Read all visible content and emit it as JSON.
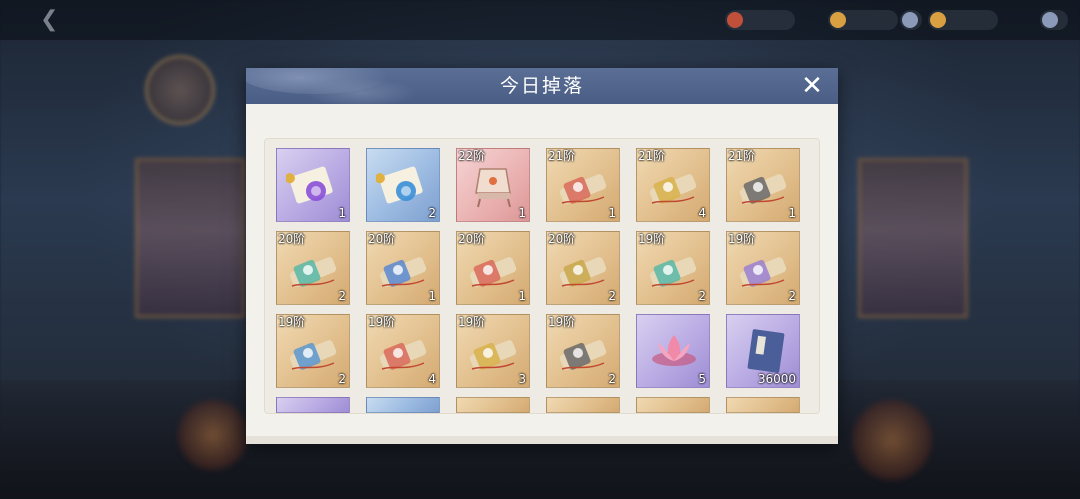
{
  "background": {
    "back_icon": "back-arrow-icon",
    "title": "",
    "resources": [
      {
        "color": "#c0503a"
      },
      {
        "color": "#d8a040"
      },
      {
        "color": "#8a9ab8"
      },
      {
        "color": "#d8a040"
      },
      {
        "color": "#8a9ab8"
      }
    ]
  },
  "modal": {
    "title": "今日掉落",
    "close_icon": "close-icon",
    "header_color": "#4e6189",
    "items": [
      {
        "tier": "",
        "qty": "1",
        "frame": "purple",
        "icon": "purple-scroll-icon",
        "tint": "#8a4fd8"
      },
      {
        "tier": "",
        "qty": "2",
        "frame": "blue",
        "icon": "blue-scroll-icon",
        "tint": "#3a8fd8"
      },
      {
        "tier": "22阶",
        "qty": "1",
        "frame": "red",
        "icon": "chair-icon",
        "tint": "#e8c8b8"
      },
      {
        "tier": "21阶",
        "qty": "1",
        "frame": "gold",
        "icon": "bundle-icon",
        "tint": "#d96a5a"
      },
      {
        "tier": "21阶",
        "qty": "4",
        "frame": "gold",
        "icon": "bundle-icon",
        "tint": "#d8b24a"
      },
      {
        "tier": "21阶",
        "qty": "1",
        "frame": "gold",
        "icon": "bundle-icon",
        "tint": "#6a6a6a"
      },
      {
        "tier": "20阶",
        "qty": "2",
        "frame": "gold",
        "icon": "bundle-icon",
        "tint": "#58b8a8"
      },
      {
        "tier": "20阶",
        "qty": "1",
        "frame": "gold",
        "icon": "bundle-icon",
        "tint": "#5a88d0"
      },
      {
        "tier": "20阶",
        "qty": "1",
        "frame": "gold",
        "icon": "bundle-icon",
        "tint": "#d96a5a"
      },
      {
        "tier": "20阶",
        "qty": "2",
        "frame": "gold",
        "icon": "bundle-icon",
        "tint": "#c8a84a"
      },
      {
        "tier": "19阶",
        "qty": "2",
        "frame": "gold",
        "icon": "bundle-icon",
        "tint": "#58b8a8"
      },
      {
        "tier": "19阶",
        "qty": "2",
        "frame": "gold",
        "icon": "bundle-icon",
        "tint": "#9a80d0"
      },
      {
        "tier": "19阶",
        "qty": "2",
        "frame": "gold",
        "icon": "bundle-icon",
        "tint": "#5a98d0"
      },
      {
        "tier": "19阶",
        "qty": "4",
        "frame": "gold",
        "icon": "bundle-icon",
        "tint": "#d96a5a"
      },
      {
        "tier": "19阶",
        "qty": "3",
        "frame": "gold",
        "icon": "bundle-icon",
        "tint": "#d8b24a"
      },
      {
        "tier": "19阶",
        "qty": "2",
        "frame": "gold",
        "icon": "bundle-icon",
        "tint": "#6a6a6a"
      },
      {
        "tier": "",
        "qty": "5",
        "frame": "purple",
        "icon": "lotus-icon",
        "tint": "#f08aa8"
      },
      {
        "tier": "",
        "qty": "36000",
        "frame": "purple",
        "icon": "book-icon",
        "tint": "#4a5e9a"
      }
    ],
    "partial_items": [
      {
        "frame": "purple",
        "icon": "scroll-icon"
      },
      {
        "frame": "blue",
        "icon": "scroll-icon"
      },
      {
        "frame": "gold",
        "icon": "bundle-icon"
      },
      {
        "frame": "gold",
        "icon": "bundle-icon"
      },
      {
        "frame": "gold",
        "icon": "bundle-icon"
      },
      {
        "frame": "gold",
        "icon": "bundle-icon"
      }
    ]
  }
}
